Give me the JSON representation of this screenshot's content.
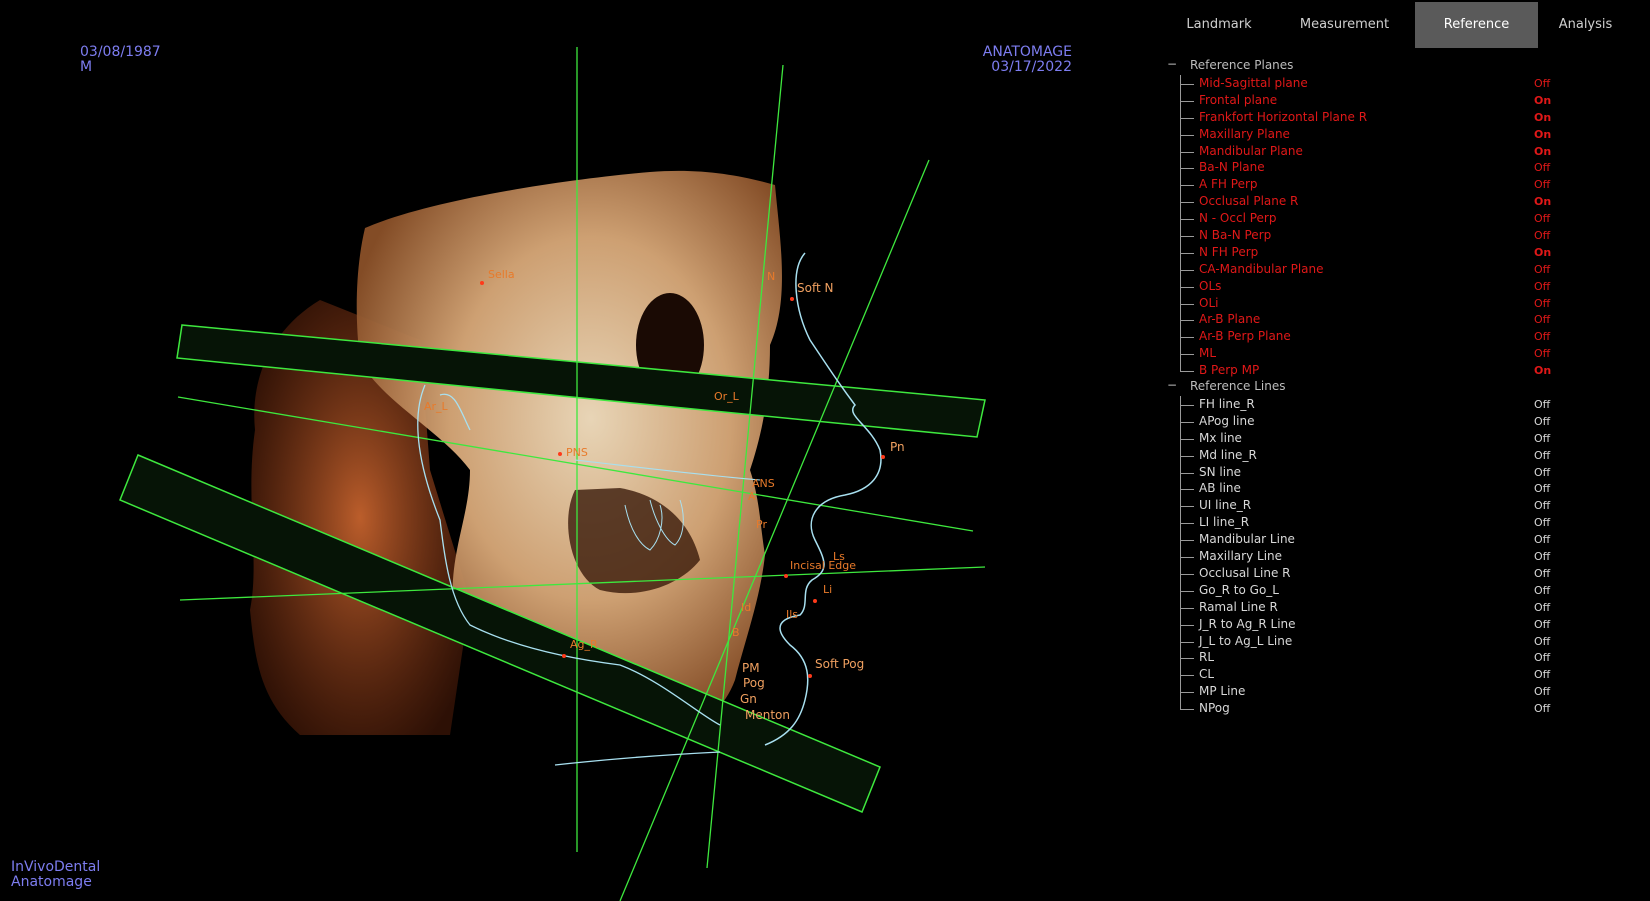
{
  "patient": {
    "dob": "03/08/1987",
    "sex": "M"
  },
  "study": {
    "vendor": "ANATOMAGE",
    "date": "03/17/2022"
  },
  "branding": {
    "line1": "InVivoDental",
    "line2": "Anatomage"
  },
  "tabs": [
    {
      "label": "Landmark",
      "active": false
    },
    {
      "label": "Measurement",
      "active": false
    },
    {
      "label": "Reference",
      "active": true
    },
    {
      "label": "Analysis",
      "active": false
    }
  ],
  "reference_planes": {
    "title": "Reference Planes",
    "toggle": "−",
    "items": [
      {
        "name": "Mid-Sagittal plane",
        "state": "Off"
      },
      {
        "name": "Frontal plane",
        "state": "On"
      },
      {
        "name": "Frankfort Horizontal Plane R",
        "state": "On"
      },
      {
        "name": "Maxillary Plane",
        "state": "On"
      },
      {
        "name": "Mandibular Plane",
        "state": "On"
      },
      {
        "name": "Ba-N Plane",
        "state": "Off"
      },
      {
        "name": "A FH Perp",
        "state": "Off"
      },
      {
        "name": "Occlusal Plane R",
        "state": "On"
      },
      {
        "name": "N - Occl Perp",
        "state": "Off"
      },
      {
        "name": "N Ba-N Perp",
        "state": "Off"
      },
      {
        "name": "N FH Perp",
        "state": "On"
      },
      {
        "name": "CA-Mandibular Plane",
        "state": "Off"
      },
      {
        "name": "OLs",
        "state": "Off"
      },
      {
        "name": "OLi",
        "state": "Off"
      },
      {
        "name": "Ar-B Plane",
        "state": "Off"
      },
      {
        "name": "Ar-B Perp Plane",
        "state": "Off"
      },
      {
        "name": "ML",
        "state": "Off"
      },
      {
        "name": "B Perp MP",
        "state": "On"
      }
    ]
  },
  "reference_lines": {
    "title": "Reference Lines",
    "toggle": "−",
    "items": [
      {
        "name": "FH line_R",
        "state": "Off"
      },
      {
        "name": "APog line",
        "state": "Off"
      },
      {
        "name": "Mx line",
        "state": "Off"
      },
      {
        "name": "Md line_R",
        "state": "Off"
      },
      {
        "name": "SN line",
        "state": "Off"
      },
      {
        "name": "AB line",
        "state": "Off"
      },
      {
        "name": "UI line_R",
        "state": "Off"
      },
      {
        "name": "LI line_R",
        "state": "Off"
      },
      {
        "name": "Mandibular Line",
        "state": "Off"
      },
      {
        "name": "Maxillary Line",
        "state": "Off"
      },
      {
        "name": "Occlusal Line R",
        "state": "Off"
      },
      {
        "name": "Go_R to Go_L",
        "state": "Off"
      },
      {
        "name": "Ramal Line R",
        "state": "Off"
      },
      {
        "name": "J_R to Ag_R Line",
        "state": "Off"
      },
      {
        "name": "J_L to Ag_L Line",
        "state": "Off"
      },
      {
        "name": "RL",
        "state": "Off"
      },
      {
        "name": "CL",
        "state": "Off"
      },
      {
        "name": "MP Line",
        "state": "Off"
      },
      {
        "name": "NPog",
        "state": "Off"
      }
    ]
  },
  "landmarks": {
    "sella": "Sella",
    "soft_n": "Soft N",
    "n": "N",
    "pns": "PNS",
    "ans": "ANS",
    "a": "A",
    "pn": "Pn",
    "pr": "Pr",
    "ls": "Ls",
    "li": "Li",
    "ils": "Ils",
    "id": "Id",
    "b": "B",
    "pm": "PM",
    "pog": "Pog",
    "gn": "Gn",
    "menton": "Menton",
    "soft_pog": "Soft Pog",
    "ag_r": "Ag_R",
    "ar_l": "Ar_L",
    "or_l": "Or_L",
    "incisal_edge": "Incisal Edge"
  },
  "colors": {
    "plane_green": "#3ee83e",
    "tracing": "#a8e0f0",
    "landmark": "#e87a2a",
    "overlay_text": "#7d7df0",
    "on_off_red": "#e01818",
    "active_tab": "#5a5a5a"
  }
}
